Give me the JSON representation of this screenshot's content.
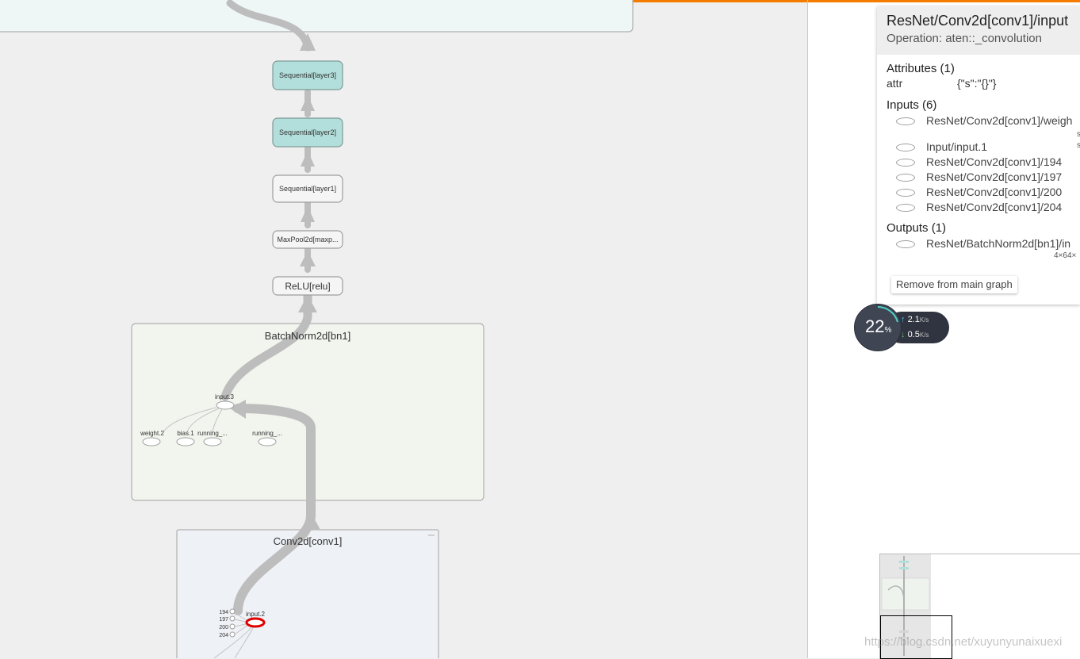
{
  "colors": {
    "accent": "#f57c00",
    "edge": "#bdbdbd",
    "layer_fill": "#b2dfdb",
    "selected": "#e00000"
  },
  "graph": {
    "nodes": {
      "layer3": "Sequential[layer3]",
      "layer2": "Sequential[layer2]",
      "layer1": "Sequential[layer1]",
      "maxpool": "MaxPool2d[maxp...",
      "relu": "ReLU[relu]"
    },
    "bn1": {
      "title": "BatchNorm2d[bn1]",
      "input": "input.3",
      "params": [
        "weight.2",
        "bias.1",
        "running_...",
        "running_..."
      ]
    },
    "conv1": {
      "title": "Conv2d[conv1]",
      "input": "input.2",
      "consts": [
        "194",
        "197",
        "200",
        "204"
      ]
    }
  },
  "info": {
    "title": "ResNet/Conv2d[conv1]/input",
    "operation": "Operation: aten::_convolution",
    "attributes_header": "Attributes (1)",
    "attr_key": "attr",
    "attr_value": "{\"s\":\"{}\"}",
    "inputs_header": "Inputs (6)",
    "inputs": [
      "ResNet/Conv2d[conv1]/weigh",
      "Input/input.1",
      "ResNet/Conv2d[conv1]/194",
      "ResNet/Conv2d[conv1]/197",
      "ResNet/Conv2d[conv1]/200",
      "ResNet/Conv2d[conv1]/204"
    ],
    "outputs_header": "Outputs (1)",
    "outputs": [
      "ResNet/BatchNorm2d[bn1]/in"
    ],
    "output_shape": "4×64×",
    "remove_button": "Remove from main graph"
  },
  "network": {
    "percent": "22",
    "percent_unit": "%",
    "up_value": "2.1",
    "up_unit": "K/s",
    "down_value": "0.5",
    "down_unit": "K/s"
  },
  "watermark": "https://blog.csdn.net/xuyunyunaixuexi"
}
